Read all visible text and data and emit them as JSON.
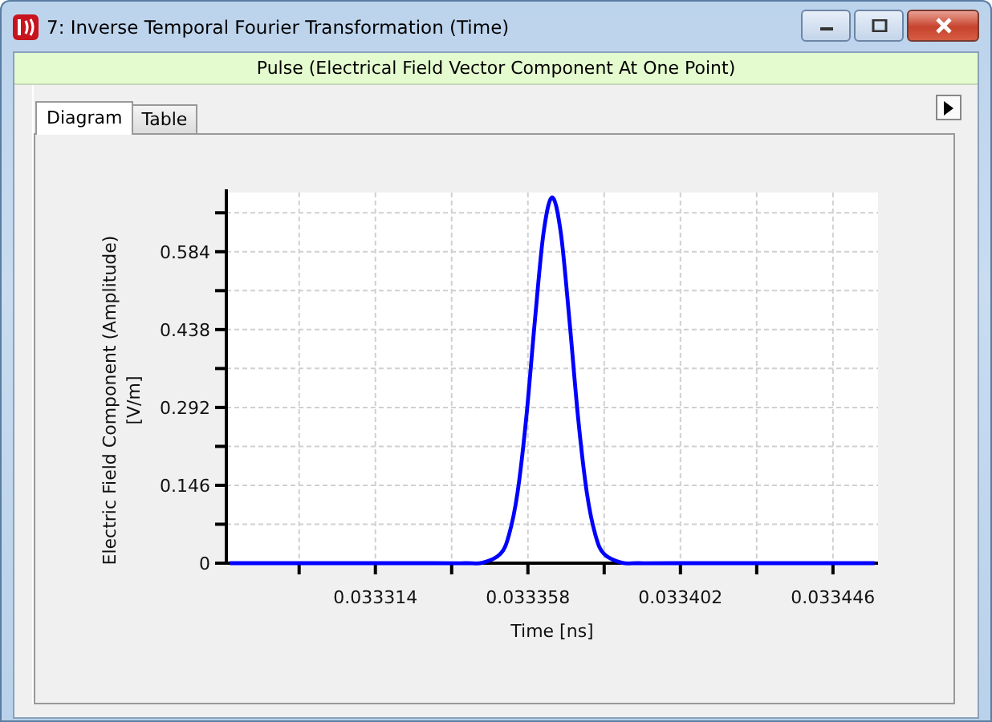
{
  "window": {
    "title": "7: Inverse Temporal Fourier Transformation (Time)"
  },
  "banner": "Pulse (Electrical Field Vector Component At One Point)",
  "tabs": [
    {
      "label": "Diagram",
      "selected": true
    },
    {
      "label": "Table",
      "selected": false
    }
  ],
  "chart_data": {
    "type": "line",
    "xlabel": "Time [ns]",
    "ylabel": "Electric Field Component (Amplitude)\n[V/m]",
    "x": [
      0.033272,
      0.0333,
      0.03333,
      0.03334,
      0.033345,
      0.03335,
      0.0333525,
      0.033355,
      0.0333575,
      0.03336,
      0.0333625,
      0.033365,
      0.0333675,
      0.03337,
      0.0333725,
      0.033375,
      0.0333775,
      0.03338,
      0.033385,
      0.03339,
      0.0334,
      0.03343,
      0.033458
    ],
    "series": [
      {
        "color": "#0000ff",
        "values": [
          0,
          0,
          0,
          0,
          0.001,
          0.017,
          0.052,
          0.132,
          0.271,
          0.454,
          0.619,
          0.686,
          0.619,
          0.454,
          0.271,
          0.132,
          0.052,
          0.017,
          0.001,
          0,
          0,
          0,
          0
        ]
      }
    ],
    "grid": true,
    "xlim": [
      0.033271,
      0.033459
    ],
    "ylim": [
      0,
      0.695
    ],
    "xticks": [
      0.033314,
      0.033358,
      0.033402,
      0.033446
    ],
    "yticks": [
      0,
      0.146,
      0.292,
      0.438,
      0.584
    ]
  }
}
